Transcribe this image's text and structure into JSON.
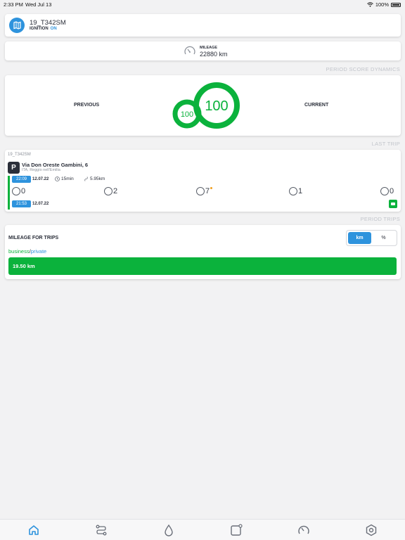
{
  "status_bar": {
    "time": "2:33 PM",
    "date": "Wed Jul 13",
    "battery": "100%"
  },
  "vehicle": {
    "name": "19_T342SM",
    "ignition_label": "IGNITION",
    "ignition_state": "ON"
  },
  "mileage": {
    "label": "MILEAGE",
    "value": "22880 km"
  },
  "score_section": {
    "title": "PERIOD SCORE DYNAMICS",
    "previous_label": "PREVIOUS",
    "current_label": "CURRENT",
    "previous_score": "100",
    "current_score": "100",
    "previous_fraction": 1.0,
    "current_fraction": 1.0
  },
  "last_trip": {
    "title": "LAST TRIP",
    "vehicle_id": "19_T342SM",
    "parking_letter": "P",
    "address": "Via Don Oreste Gambini, 6",
    "city": "ITA, Reggio nell'Emilia",
    "end_time": "22:09",
    "end_date": "12.07.22",
    "duration": "15min",
    "distance": "5.95km",
    "start_time": "21:53",
    "start_date": "12.07.22",
    "events": [
      {
        "icon": "acceleration-icon",
        "count": "0"
      },
      {
        "icon": "braking-icon",
        "count": "2"
      },
      {
        "icon": "cornering-icon",
        "count": "7"
      },
      {
        "icon": "speeding-icon",
        "count": "1"
      },
      {
        "icon": "phone-usage-icon",
        "count": "0"
      }
    ]
  },
  "period_trips": {
    "title": "PERIOD TRIPS",
    "card_title": "MILEAGE FOR  TRIPS",
    "unit_km": "km",
    "unit_percent": "%",
    "legend_business": "business",
    "legend_sep": "/",
    "legend_private": "private",
    "bar_value": "19.50 km",
    "business_fraction": 1.0
  },
  "tabs": [
    "home-icon",
    "trips-icon",
    "fuel-icon",
    "notes-icon",
    "speedometer-icon",
    "settings-icon"
  ],
  "colors": {
    "accent": "#2e93dd",
    "green": "#0bb23c",
    "text": "#2b2f3a"
  }
}
